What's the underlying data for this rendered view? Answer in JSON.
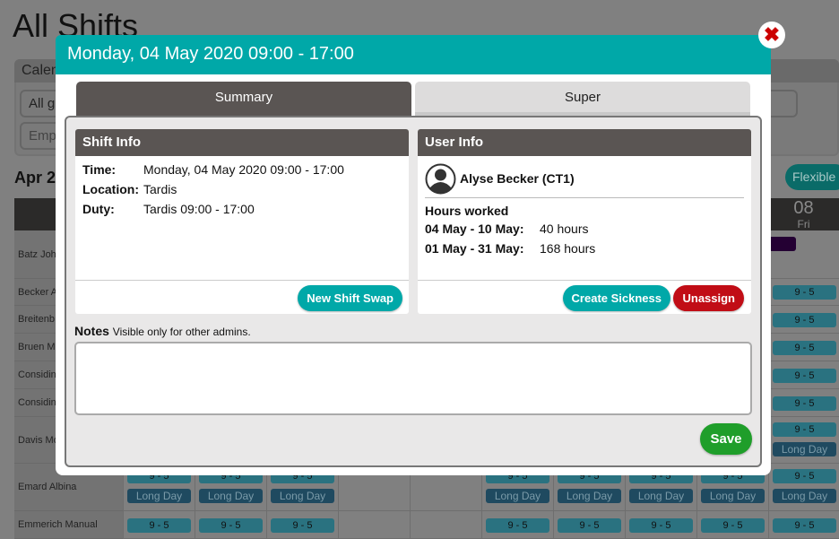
{
  "page": {
    "title": "All Shifts",
    "calendar_label": "Calen",
    "group_select": "All g",
    "employee_placeholder": "Empl",
    "week_label": "Apr 2",
    "flexible_label": "Flexible",
    "day_header": {
      "num": "08",
      "day": "Fri"
    },
    "purple_badge": "t",
    "badge_95": "9 - 5",
    "badge_long": "Long Day",
    "rows": [
      {
        "name": "Batz Joh"
      },
      {
        "name": "Becker A"
      },
      {
        "name": "Breitenb"
      },
      {
        "name": "Bruen M"
      },
      {
        "name": "Considin"
      },
      {
        "name": "Considin"
      },
      {
        "name": "Davis Mo"
      },
      {
        "name": "Emard Albina"
      },
      {
        "name": "Emmerich Manual"
      }
    ]
  },
  "modal": {
    "title": "Monday, 04 May 2020 09:00 - 17:00",
    "close_icon": "close-x-icon",
    "tabs": [
      {
        "label": "Summary",
        "active": true
      },
      {
        "label": "Super",
        "active": false
      }
    ],
    "shift_info": {
      "heading": "Shift Info",
      "fields": [
        {
          "label": "Time:",
          "value": "Monday, 04 May 2020 09:00 - 17:00"
        },
        {
          "label": "Location:",
          "value": "Tardis"
        },
        {
          "label": "Duty:",
          "value": "Tardis 09:00 - 17:00"
        }
      ],
      "swap_button": "New Shift Swap"
    },
    "user_info": {
      "heading": "User Info",
      "user_name": "Alyse Becker (CT1)",
      "hours_heading": "Hours worked",
      "hours": [
        {
          "range": "04 May - 10 May:",
          "value": "40 hours"
        },
        {
          "range": "01 May - 31 May:",
          "value": "168 hours"
        }
      ],
      "sickness_button": "Create Sickness",
      "unassign_button": "Unassign"
    },
    "notes": {
      "label": "Notes",
      "hint": "Visible only for other admins.",
      "value": ""
    },
    "save_button": "Save"
  },
  "colors": {
    "teal": "#00a8a8",
    "dark": "#5a5553",
    "danger": "#c10d16",
    "success": "#1f9e2a"
  }
}
